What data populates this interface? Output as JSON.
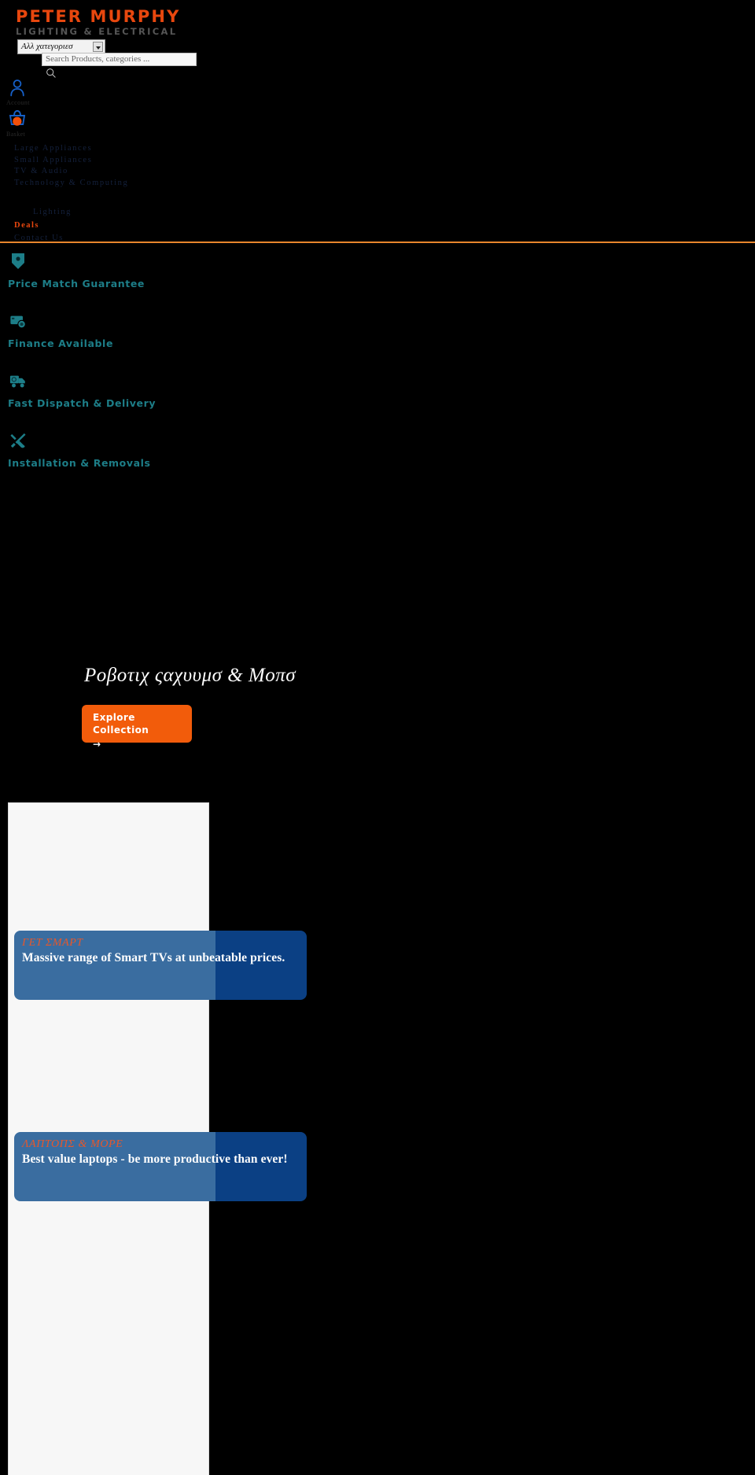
{
  "header": {
    "logo_main": "PETER MURPHY",
    "logo_sub": "LIGHTING & ELECTRICAL",
    "search": {
      "category_value": "Αλλ χατεγοριεσ",
      "placeholder": "Search Products, categories ...",
      "search_icon": "search-icon"
    },
    "account": {
      "label": "Account",
      "icon": "user-icon"
    },
    "basket": {
      "label": "Basket",
      "icon": "basket-icon",
      "badge_color": "#F2500A"
    }
  },
  "nav": {
    "items": [
      {
        "label": "Large Appliances"
      },
      {
        "label": "Small Appliances"
      },
      {
        "label": "TV & Audio"
      },
      {
        "label": "Technology & Computing"
      },
      {
        "label": "Lighting"
      },
      {
        "label": "Deals"
      },
      {
        "label": "Contact Us"
      }
    ],
    "divider_color": "#E8862C"
  },
  "features": [
    {
      "label": "Price Match Guarantee",
      "icon": "price-tag-icon"
    },
    {
      "label": "Finance Available",
      "icon": "credit-card-icon"
    },
    {
      "label": "Fast Dispatch & Delivery",
      "icon": "delivery-truck-icon"
    },
    {
      "label": "Installation & Removals",
      "icon": "tools-icon"
    }
  ],
  "feature_color": "#1D7E88",
  "hero": {
    "title": "Ροβοτιχ ςαχυυμσ & Μοπσ",
    "button_label": "Explore Collection",
    "button_arrow": "→",
    "button_color": "#F25C0B"
  },
  "promos": [
    {
      "kicker": "ΓΕΤ ΣΜΑΡΤ",
      "headline": "Massive range of Smart TVs at unbeatable prices.",
      "bg_left": "#3A6DA0",
      "bg_right": "#0B4084"
    },
    {
      "kicker": "ΛΑΠΤΟΠΣ & ΜΟΡΕ",
      "headline": "Best value laptops - be more productive than ever!",
      "bg_left": "#3A6DA0",
      "bg_right": "#0B4084"
    }
  ]
}
